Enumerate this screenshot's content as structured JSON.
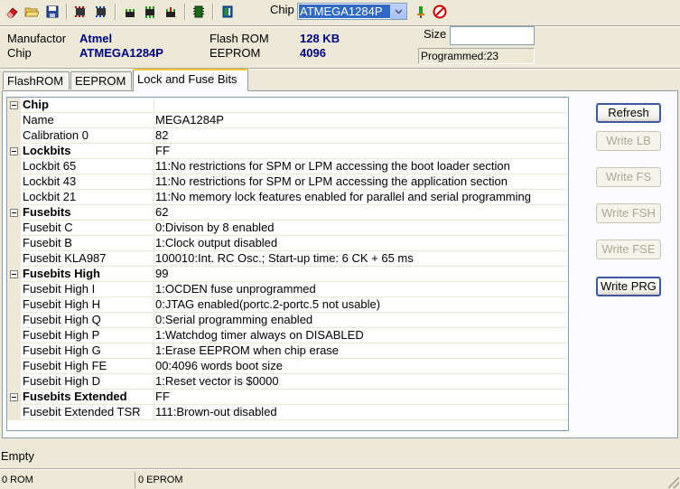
{
  "toolbar": {
    "buttons": [
      {
        "icon": "eraser-icon"
      },
      {
        "icon": "open-folder-icon"
      },
      {
        "icon": "save-icon"
      },
      {
        "icon": "read-chip-icon"
      },
      {
        "icon": "write-chip-icon"
      },
      {
        "icon": "verify-icon"
      },
      {
        "icon": "compare-icon"
      },
      {
        "icon": "lock-icon"
      },
      {
        "icon": "chip-icon"
      },
      {
        "icon": "settings-icon"
      },
      {
        "icon": "connect-icon"
      },
      {
        "icon": "stop-icon"
      }
    ],
    "chip_label": "Chip",
    "chip_value": "ATMEGA1284P"
  },
  "info": {
    "manufacturer_label": "Manufactor",
    "manufacturer_value": "Atmel",
    "chip_label": "Chip",
    "chip_value": "ATMEGA1284P",
    "flash_label": "Flash ROM",
    "flash_value": "128 KB",
    "eeprom_label": "EEPROM",
    "eeprom_value": "4096",
    "size_label": "Size",
    "size_value": "",
    "programmed": "Programmed:23"
  },
  "tabs": [
    {
      "label": "FlashROM"
    },
    {
      "label": "EEPROM"
    },
    {
      "label": "Lock and Fuse Bits"
    }
  ],
  "grid": [
    {
      "cat": true,
      "name": "Chip",
      "value": ""
    },
    {
      "cat": false,
      "name": "Name",
      "value": "MEGA1284P"
    },
    {
      "cat": false,
      "name": "Calibration 0",
      "value": "82"
    },
    {
      "cat": true,
      "name": "Lockbits",
      "value": "FF"
    },
    {
      "cat": false,
      "name": "Lockbit 65",
      "value": "11:No restrictions for SPM or LPM accessing the boot loader section"
    },
    {
      "cat": false,
      "name": "Lockbit 43",
      "value": "11:No restrictions for SPM or LPM accessing the application section"
    },
    {
      "cat": false,
      "name": "Lockbit 21",
      "value": "11:No memory lock features enabled for parallel and serial programming"
    },
    {
      "cat": true,
      "name": "Fusebits",
      "value": "62"
    },
    {
      "cat": false,
      "name": "Fusebit C",
      "value": "0:Divison by 8 enabled"
    },
    {
      "cat": false,
      "name": "Fusebit B",
      "value": "1:Clock output disabled"
    },
    {
      "cat": false,
      "name": "Fusebit KLA987",
      "value": "100010:Int. RC Osc.; Start-up time: 6 CK + 65 ms"
    },
    {
      "cat": true,
      "name": "Fusebits High",
      "value": "99"
    },
    {
      "cat": false,
      "name": "Fusebit High I",
      "value": "1:OCDEN fuse unprogrammed"
    },
    {
      "cat": false,
      "name": "Fusebit High H",
      "value": "0:JTAG enabled(portc.2-portc.5 not usable)"
    },
    {
      "cat": false,
      "name": "Fusebit High Q",
      "value": "0:Serial programming enabled"
    },
    {
      "cat": false,
      "name": "Fusebit High P",
      "value": "1:Watchdog timer always on DISABLED"
    },
    {
      "cat": false,
      "name": "Fusebit High G",
      "value": "1:Erase EEPROM when chip erase"
    },
    {
      "cat": false,
      "name": "Fusebit High FE",
      "value": "00:4096 words boot size"
    },
    {
      "cat": false,
      "name": "Fusebit High D",
      "value": "1:Reset vector is $0000"
    },
    {
      "cat": true,
      "name": "Fusebits Extended",
      "value": "FF"
    },
    {
      "cat": false,
      "name": "Fusebit Extended TSR",
      "value": "111:Brown-out disabled"
    }
  ],
  "buttons": {
    "refresh": "Refresh",
    "write_lb": "Write LB",
    "write_fs": "Write FS",
    "write_fsh": "Write FSH",
    "write_fse": "Write FSE",
    "write_prg": "Write PRG"
  },
  "message": "Empty",
  "status": {
    "rom": "0 ROM",
    "eprom": "0 EPROM"
  }
}
